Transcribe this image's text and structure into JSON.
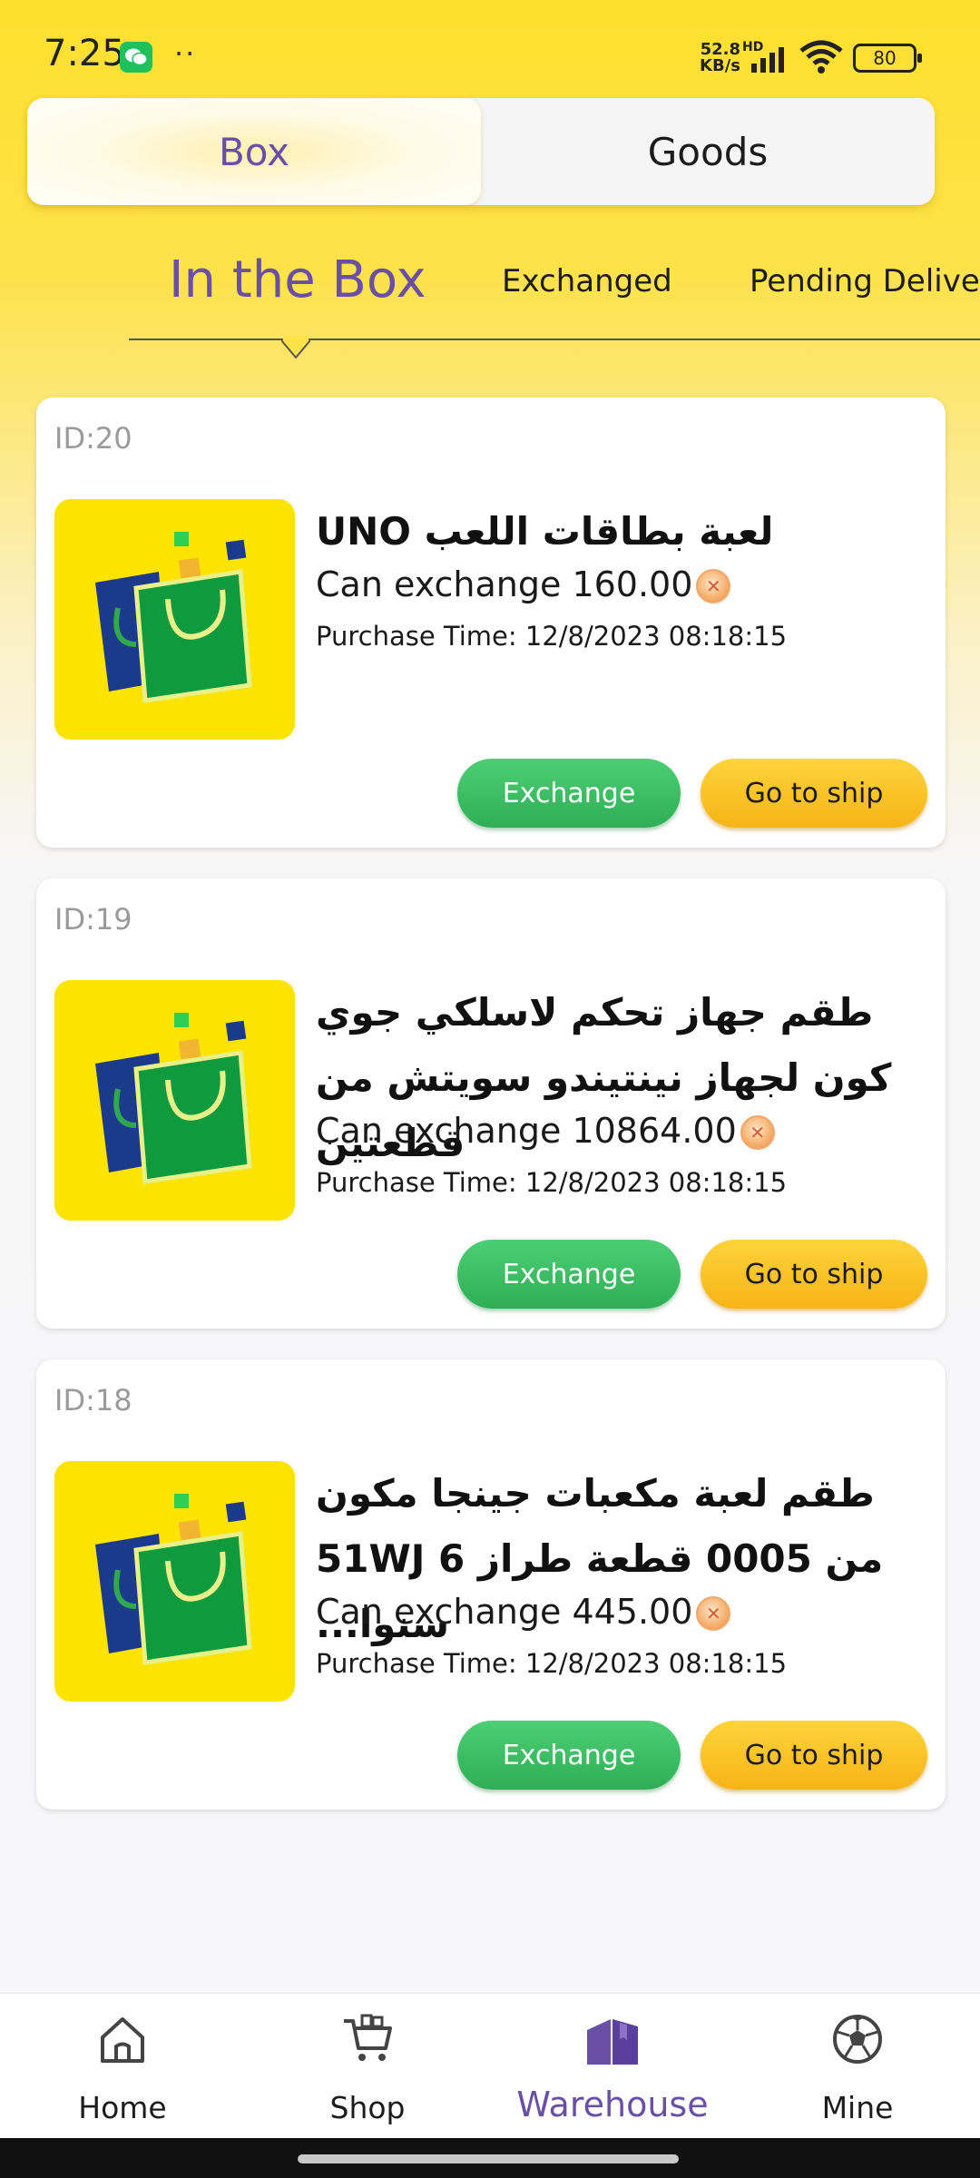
{
  "status_bar": {
    "time": "7:25",
    "dots": "··",
    "net_speed": "52.8",
    "net_unit": "KB/s",
    "net_type": "HD",
    "battery": "80",
    "icons": [
      "wechat-icon",
      "signal-icon",
      "wifi-icon",
      "battery-icon"
    ]
  },
  "segment": {
    "box_label": "Box",
    "goods_label": "Goods",
    "active": "Box"
  },
  "subtabs": {
    "items": [
      "In the Box",
      "Exchanged",
      "Pending Delive"
    ],
    "active": "In the Box"
  },
  "cards": [
    {
      "id": "ID:20",
      "title": "لعبة بطاقات اللعب UNO",
      "exchange": "Can exchange 160.00",
      "purchase": "Purchase Time: 12/8/2023 08:18:15",
      "exchange_btn": "Exchange",
      "ship_btn": "Go to ship"
    },
    {
      "id": "ID:19",
      "title": "طقم جهاز تحكم لاسلكي جوي كون لجهاز نينتيندو سويتش من قطعتين",
      "exchange": "Can exchange 10864.00",
      "purchase": "Purchase Time: 12/8/2023 08:18:15",
      "exchange_btn": "Exchange",
      "ship_btn": "Go to ship"
    },
    {
      "id": "ID:18",
      "title": "طقم لعبة مكعبات جينجا مكون من 0005 قطعة طراز 51WJ 6 سنوا...",
      "exchange": "Can exchange 445.00",
      "purchase": "Purchase Time: 12/8/2023 08:18:15",
      "exchange_btn": "Exchange",
      "ship_btn": "Go to ship"
    }
  ],
  "bottom_nav": {
    "items": [
      {
        "label": "Home",
        "icon": "home-icon"
      },
      {
        "label": "Shop",
        "icon": "cart-icon"
      },
      {
        "label": "Warehouse",
        "icon": "warehouse-icon"
      },
      {
        "label": "Mine",
        "icon": "soccer-ball-icon"
      }
    ],
    "active": "Warehouse"
  },
  "colors": {
    "accent_purple": "#6a4fa6",
    "header_yellow": "#fde02c",
    "exchange_green": "#3cbf63",
    "ship_yellow": "#f9c22a"
  }
}
